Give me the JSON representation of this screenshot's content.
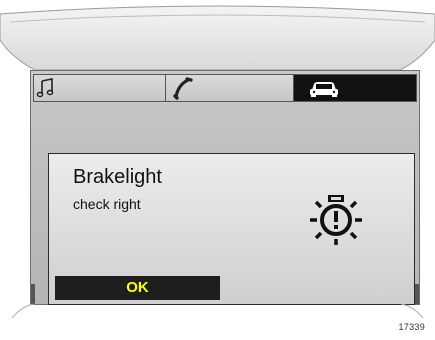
{
  "tabs": [
    {
      "icon": "music-note-icon",
      "active": false
    },
    {
      "icon": "phone-handset-icon",
      "active": false
    },
    {
      "icon": "car-icon",
      "active": true
    }
  ],
  "message": {
    "title": "Brakelight",
    "subtitle": "check right",
    "icon": "bulb-warning-icon",
    "ok_label": "OK"
  },
  "reference_number": "17339",
  "colors": {
    "ok_text": "#ffff00",
    "ok_background": "#1e1e1e",
    "active_tab": "#111111"
  }
}
